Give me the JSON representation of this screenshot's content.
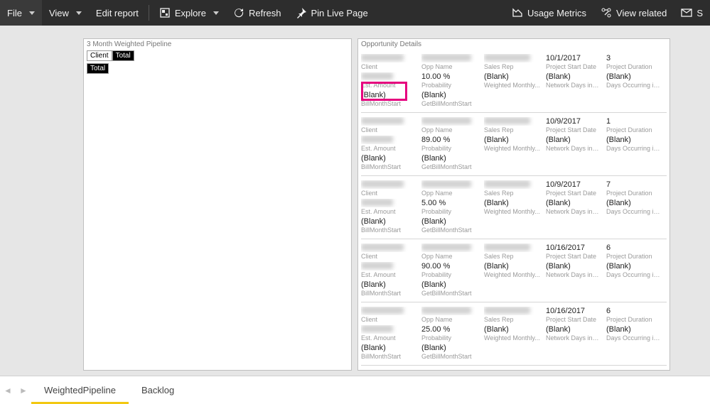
{
  "toolbar": {
    "file": "File",
    "view": "View",
    "edit_report": "Edit report",
    "explore": "Explore",
    "refresh": "Refresh",
    "pin": "Pin Live Page",
    "usage": "Usage Metrics",
    "related": "View related",
    "subscribe_initial": "S"
  },
  "pipeline": {
    "title": "3 Month Weighted Pipeline",
    "col_client": "Client",
    "col_total": "Total",
    "row_total": "Total"
  },
  "details": {
    "title": "Opportunity Details",
    "labels": {
      "client": "Client",
      "opp": "Opp Name",
      "rep": "Sales Rep",
      "start": "Project Start Date",
      "dur": "Project Duration",
      "amt": "Est. Amount",
      "prob": "Probability",
      "wm": "Weighted Monthly...",
      "nd": "Network Days in P...",
      "do": "Days Occurring in Mo...",
      "bms": "BillMonthStart",
      "gbms": "GetBillMonthStart"
    },
    "cards": [
      {
        "start": "10/1/2017",
        "dur": "3",
        "prob": "10.00 %",
        "amt_blur": true,
        "wm": "(Blank)",
        "nd": "(Blank)",
        "do": "(Blank)",
        "bms": "(Blank)",
        "gbms": "(Blank)"
      },
      {
        "start": "10/9/2017",
        "dur": "1",
        "prob": "89.00 %",
        "amt_blur": true,
        "wm": "(Blank)",
        "nd": "(Blank)",
        "do": "(Blank)",
        "bms": "(Blank)",
        "gbms": "(Blank)"
      },
      {
        "start": "10/9/2017",
        "dur": "7",
        "prob": "5.00 %",
        "amt_blur": true,
        "wm": "(Blank)",
        "nd": "(Blank)",
        "do": "(Blank)",
        "bms": "(Blank)",
        "gbms": "(Blank)"
      },
      {
        "start": "10/16/2017",
        "dur": "6",
        "prob": "90.00 %",
        "amt_blur": true,
        "wm": "(Blank)",
        "nd": "(Blank)",
        "do": "(Blank)",
        "bms": "(Blank)",
        "gbms": "(Blank)"
      },
      {
        "start": "10/16/2017",
        "dur": "6",
        "prob": "25.00 %",
        "amt_blur": true,
        "wm": "(Blank)",
        "nd": "(Blank)",
        "do": "(Blank)",
        "bms": "(Blank)",
        "gbms": "(Blank)"
      }
    ]
  },
  "tabs": {
    "t1": "WeightedPipeline",
    "t2": "Backlog"
  }
}
